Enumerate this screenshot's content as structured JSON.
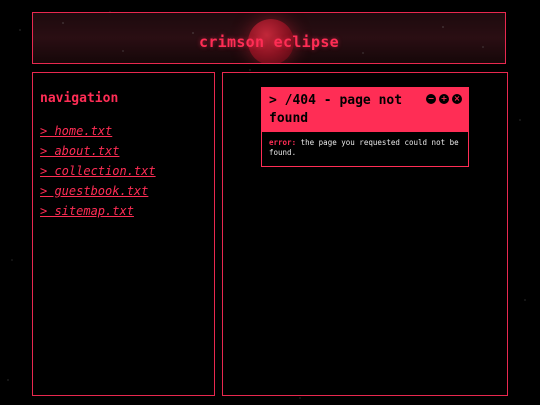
{
  "header": {
    "title": "crimson eclipse"
  },
  "navigation": {
    "heading": "navigation",
    "items": [
      {
        "label": "> home.txt"
      },
      {
        "label": "> about.txt"
      },
      {
        "label": "> collection.txt"
      },
      {
        "label": "> guestbook.txt"
      },
      {
        "label": "> sitemap.txt"
      }
    ]
  },
  "error_window": {
    "title": "> /404 - page not found",
    "controls": {
      "minimize_icon": "minus-icon",
      "maximize_icon": "plus-icon",
      "close_icon": "close-icon"
    },
    "label": "error:",
    "message": "the page you requested could not be found."
  },
  "colors": {
    "accent": "#ff2d55",
    "border": "#e8284f",
    "background": "#000000"
  }
}
